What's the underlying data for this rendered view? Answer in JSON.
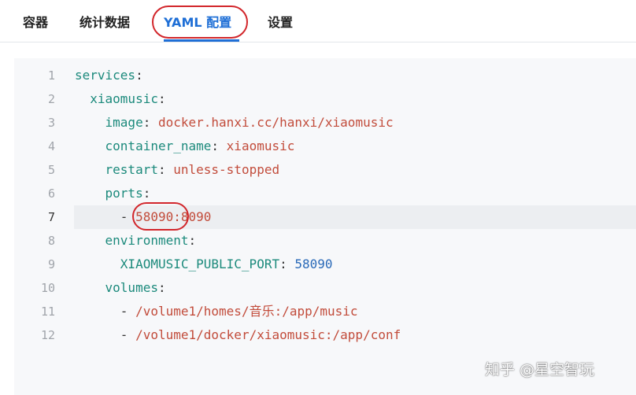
{
  "tabs": [
    {
      "label": "容器"
    },
    {
      "label": "统计数据"
    },
    {
      "label": "YAML 配置",
      "active": true
    },
    {
      "label": "设置"
    }
  ],
  "colors": {
    "accent": "#1f6fd6",
    "annotation": "#d2262b",
    "yaml_key": "#1c8a7c",
    "yaml_string": "#c24c3b",
    "yaml_number": "#2a6ab8"
  },
  "editor": {
    "highlighted_line": 7,
    "lines": [
      {
        "n": "1",
        "key": "services",
        "colon": ":"
      },
      {
        "n": "2",
        "key": "xiaomusic",
        "colon": ":"
      },
      {
        "n": "3",
        "key": "image",
        "colon": ":",
        "value": "docker.hanxi.cc/hanxi/xiaomusic"
      },
      {
        "n": "4",
        "key": "container_name",
        "colon": ":",
        "value": "xiaomusic"
      },
      {
        "n": "5",
        "key": "restart",
        "colon": ":",
        "value": "unless-stopped"
      },
      {
        "n": "6",
        "key": "ports",
        "colon": ":"
      },
      {
        "n": "7",
        "dash": "-",
        "value": "58090:8090"
      },
      {
        "n": "8",
        "key": "environment",
        "colon": ":"
      },
      {
        "n": "9",
        "key": "XIAOMUSIC_PUBLIC_PORT",
        "colon": ":",
        "num": "58090"
      },
      {
        "n": "10",
        "key": "volumes",
        "colon": ":"
      },
      {
        "n": "11",
        "dash": "-",
        "value": "/volume1/homes/音乐:/app/music"
      },
      {
        "n": "12",
        "dash": "-",
        "value": "/volume1/docker/xiaomusic:/app/conf"
      }
    ]
  },
  "watermark": "知乎 @星空智玩"
}
